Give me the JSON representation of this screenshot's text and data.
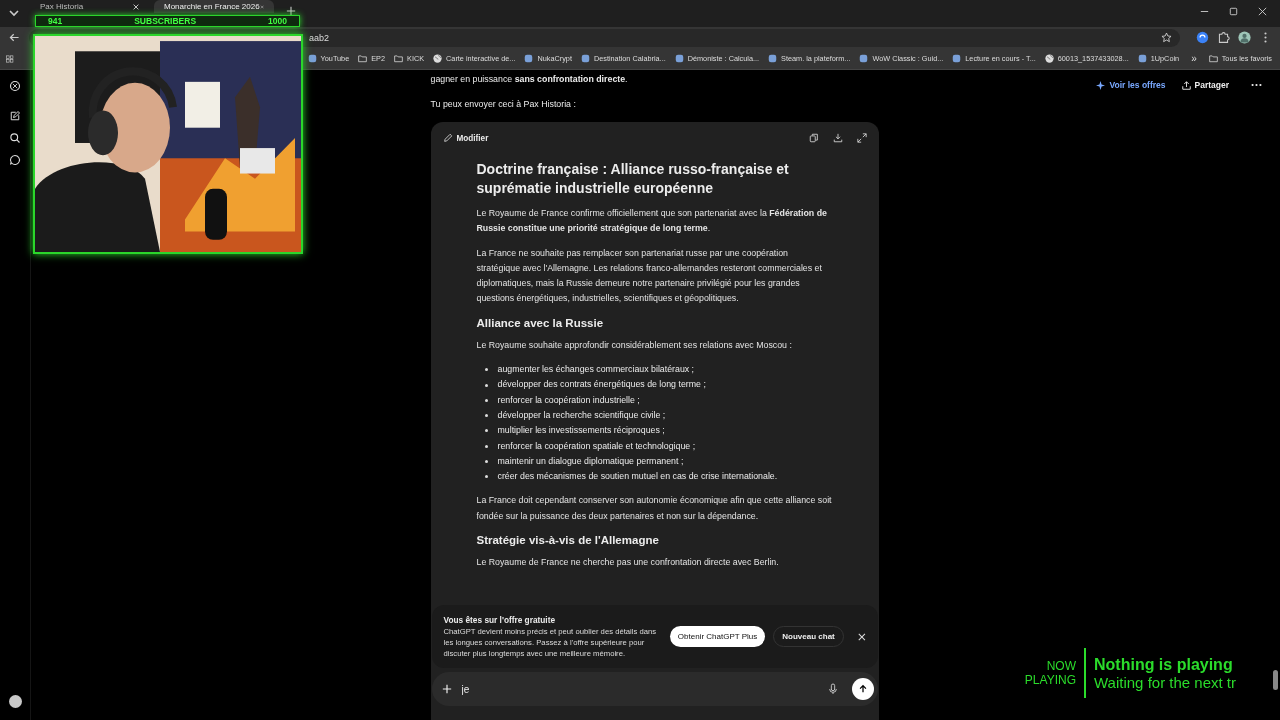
{
  "browser": {
    "tabs": [
      {
        "title": "Pax Historia",
        "selected": false
      },
      {
        "title": "Monarchie en France 2026",
        "selected": true
      }
    ],
    "address": "aab2",
    "bookmarks": [
      {
        "label": "YouTube",
        "kind": "site"
      },
      {
        "label": "EP2",
        "kind": "folder"
      },
      {
        "label": "KICK",
        "kind": "folder"
      },
      {
        "label": "Carte interactive de...",
        "kind": "globe"
      },
      {
        "label": "NukaCrypt",
        "kind": "site"
      },
      {
        "label": "Destination Calabria...",
        "kind": "site"
      },
      {
        "label": "Démoniste : Calcula...",
        "kind": "site"
      },
      {
        "label": "Steam. la plateform...",
        "kind": "site"
      },
      {
        "label": "WoW Classic : Guid...",
        "kind": "site"
      },
      {
        "label": "Lecture en cours - T...",
        "kind": "site"
      },
      {
        "label": "60013_1537433028...",
        "kind": "globe"
      },
      {
        "label": "1UpCoin",
        "kind": "site"
      }
    ],
    "overflow": "»",
    "all_bookmarks": "Tous les favoris"
  },
  "header_actions": {
    "offers": "Voir les offres",
    "share": "Partager"
  },
  "conversation": [
    "gagner en puissance **sans confrontation directe**.",
    "Tu peux envoyer ceci à Pax Historia :"
  ],
  "canvas": {
    "action": "Modifier",
    "title": "Doctrine française : Alliance russo-française et suprématie industrielle européenne",
    "blocks": [
      {
        "kind": "p",
        "text": "Le Royaume de France confirme officiellement que son partenariat avec la **Fédération de Russie constitue une priorité stratégique de long terme**."
      },
      {
        "kind": "p",
        "text": "La France ne souhaite pas remplacer son partenariat russe par une coopération stratégique avec l'Allemagne. Les relations franco-allemandes resteront commerciales et diplomatiques, mais la Russie demeure notre partenaire privilégié pour les grandes questions énergétiques, industrielles, scientifiques et géopolitiques."
      },
      {
        "kind": "h",
        "text": "Alliance avec la Russie"
      },
      {
        "kind": "p",
        "text": "Le Royaume souhaite approfondir considérablement ses relations avec Moscou :"
      },
      {
        "kind": "list",
        "items": [
          "augmenter les échanges commerciaux bilatéraux ;",
          "développer des contrats énergétiques de long terme ;",
          "renforcer la coopération industrielle ;",
          "développer la recherche scientifique civile ;",
          "multiplier les investissements réciproques ;",
          "renforcer la coopération spatiale et technologique ;",
          "maintenir un dialogue diplomatique permanent ;",
          "créer des mécanismes de soutien mutuel en cas de crise internationale."
        ]
      },
      {
        "kind": "p",
        "text": "La France doit cependant conserver son autonomie économique afin que cette alliance soit fondée sur la puissance des deux partenaires et non sur la dépendance."
      },
      {
        "kind": "h",
        "text": "Stratégie vis-à-vis de l'Allemagne"
      },
      {
        "kind": "p",
        "text": "Le Royaume de France ne cherche pas une confrontation directe avec Berlin."
      }
    ]
  },
  "banner": {
    "title": "Vous êtes sur l'offre gratuite",
    "text": "ChatGPT devient moins précis et peut oublier des détails dans les longues conversations. Passez à l'offre supérieure pour discuter plus longtemps avec une meilleure mémoire.",
    "primary": "Obtenir ChatGPT Plus",
    "secondary": "Nouveau chat"
  },
  "composer": {
    "value": "je"
  },
  "overlay": {
    "subscribers": {
      "current": "941",
      "label": "SUBSCRIBERS",
      "goal": "1000"
    },
    "now_playing": {
      "label": "NOW PLAYING",
      "title": "Nothing is playing",
      "subtitle": "Waiting for the next tr"
    }
  }
}
